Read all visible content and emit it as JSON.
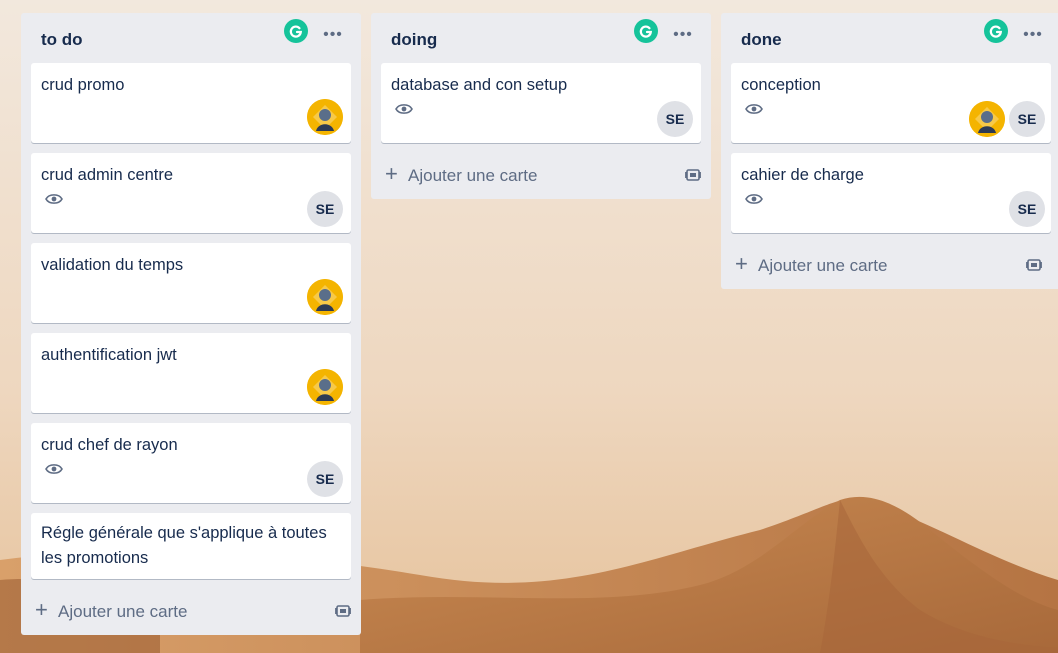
{
  "colors": {
    "list_bg": "#ebecf0",
    "card_bg": "#ffffff",
    "text": "#172b4d",
    "muted": "#5e6c84",
    "grammarly": "#15c39a",
    "avatar_initials_bg": "#dfe1e6",
    "avatar_photo_bg": "#f4b400"
  },
  "lists": [
    {
      "title": "to do",
      "add_label": "Ajouter une carte",
      "cards": [
        {
          "title": "crud promo",
          "watched": false,
          "members": [
            "photo"
          ]
        },
        {
          "title": "crud admin centre",
          "watched": true,
          "members": [
            "SE"
          ]
        },
        {
          "title": "validation du temps",
          "watched": false,
          "members": [
            "photo"
          ]
        },
        {
          "title": "authentification jwt",
          "watched": false,
          "members": [
            "photo"
          ]
        },
        {
          "title": "crud chef de rayon",
          "watched": true,
          "members": [
            "SE"
          ]
        },
        {
          "title": "Régle générale que s'applique à toutes les promotions",
          "watched": false,
          "members": []
        }
      ]
    },
    {
      "title": "doing",
      "add_label": "Ajouter une carte",
      "cards": [
        {
          "title": "database and con setup",
          "watched": true,
          "members": [
            "SE"
          ]
        }
      ]
    },
    {
      "title": "done",
      "add_label": "Ajouter une carte",
      "cards": [
        {
          "title": "conception",
          "watched": true,
          "members": [
            "photo",
            "SE"
          ]
        },
        {
          "title": "cahier de charge",
          "watched": true,
          "members": [
            "SE"
          ]
        }
      ]
    }
  ],
  "icons": {
    "grammarly": "grammarly-icon",
    "more": "more-icon",
    "watch": "eye-icon",
    "add": "plus-icon",
    "template": "card-template-icon"
  }
}
